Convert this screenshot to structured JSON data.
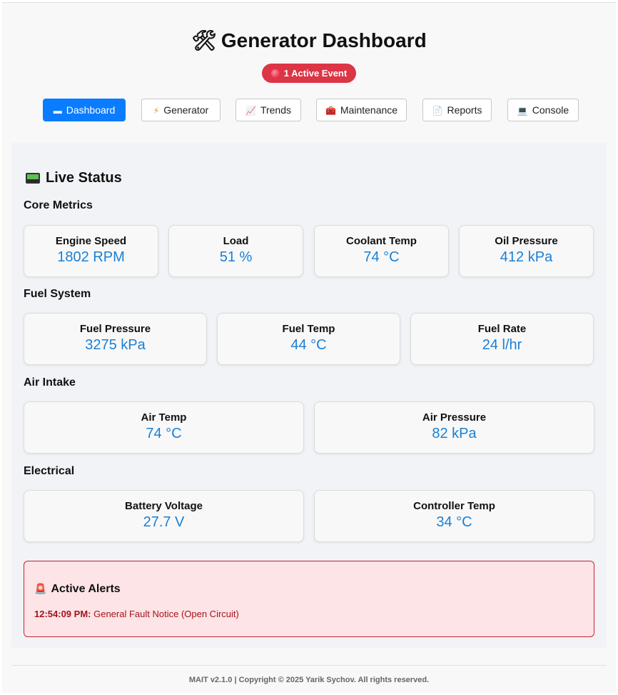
{
  "header": {
    "title": "Generator Dashboard",
    "title_icon": "hammer-and-wrench-icon",
    "event_badge": "1 Active Event"
  },
  "nav": [
    {
      "label": "Dashboard",
      "icon": "monitor-icon",
      "active": true
    },
    {
      "label": "Generator",
      "icon": "lightning-icon",
      "active": false
    },
    {
      "label": "Trends",
      "icon": "chart-icon",
      "active": false
    },
    {
      "label": "Maintenance",
      "icon": "toolbox-icon",
      "active": false
    },
    {
      "label": "Reports",
      "icon": "document-icon",
      "active": false
    },
    {
      "label": "Console",
      "icon": "computer-icon",
      "active": false
    }
  ],
  "live_status": {
    "title": "Live Status",
    "sections": [
      {
        "title": "Core Metrics",
        "metrics": [
          {
            "label": "Engine Speed",
            "value": "1802 RPM"
          },
          {
            "label": "Load",
            "value": "51 %"
          },
          {
            "label": "Coolant Temp",
            "value": "74 °C"
          },
          {
            "label": "Oil Pressure",
            "value": "412 kPa"
          }
        ]
      },
      {
        "title": "Fuel System",
        "metrics": [
          {
            "label": "Fuel Pressure",
            "value": "3275 kPa"
          },
          {
            "label": "Fuel Temp",
            "value": "44 °C"
          },
          {
            "label": "Fuel Rate",
            "value": "24 l/hr"
          }
        ]
      },
      {
        "title": "Air Intake",
        "metrics": [
          {
            "label": "Air Temp",
            "value": "74 °C"
          },
          {
            "label": "Air Pressure",
            "value": "82 kPa"
          }
        ]
      },
      {
        "title": "Electrical",
        "metrics": [
          {
            "label": "Battery Voltage",
            "value": "27.7 V"
          },
          {
            "label": "Controller Temp",
            "value": "34 °C"
          }
        ]
      }
    ]
  },
  "alerts": {
    "title": "Active Alerts",
    "items": [
      {
        "time": "12:54:09 PM:",
        "message": "General Fault Notice (Open Circuit)"
      }
    ]
  },
  "footer": "MAIT v2.1.0 | Copyright © 2025 Yarik Sychov. All rights reserved.",
  "colors": {
    "accent": "#0a7cff",
    "metric_value": "#1a7fd4",
    "alert_bg": "#fde4e6",
    "alert_border": "#c8232c",
    "badge": "#dc3545"
  }
}
